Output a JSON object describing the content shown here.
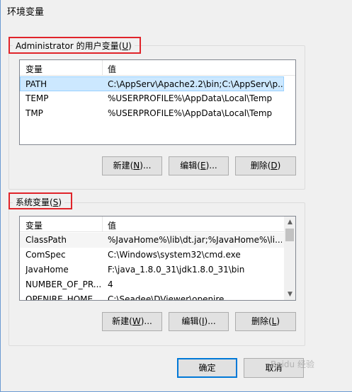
{
  "window": {
    "title": "环境变量"
  },
  "user_group": {
    "label_prefix": "Administrator 的用户变量(",
    "label_key": "U",
    "label_suffix": ")",
    "columns": [
      "变量",
      "值"
    ],
    "rows": [
      {
        "name": "PATH",
        "value": "C:\\AppServ\\Apache2.2\\bin;C:\\AppServ\\p...",
        "selected": true
      },
      {
        "name": "TEMP",
        "value": "%USERPROFILE%\\AppData\\Local\\Temp",
        "selected": false
      },
      {
        "name": "TMP",
        "value": "%USERPROFILE%\\AppData\\Local\\Temp",
        "selected": false
      }
    ],
    "buttons": {
      "new": {
        "a": "新建(",
        "k": "N",
        "b": ")..."
      },
      "edit": {
        "a": "编辑(",
        "k": "E",
        "b": ")..."
      },
      "delete": {
        "a": "删除(",
        "k": "D",
        "b": ")"
      }
    }
  },
  "system_group": {
    "label_prefix": "系统变量(",
    "label_key": "S",
    "label_suffix": ")",
    "columns": [
      "变量",
      "值"
    ],
    "rows": [
      {
        "name": "ClassPath",
        "value": "%JavaHome%\\lib\\dt.jar;%JavaHome%\\li...",
        "selected": false
      },
      {
        "name": "ComSpec",
        "value": "C:\\Windows\\system32\\cmd.exe",
        "selected": false
      },
      {
        "name": "JavaHome",
        "value": "F:\\java_1.8.0_31\\jdk1.8.0_31\\bin",
        "selected": false
      },
      {
        "name": "NUMBER_OF_PR...",
        "value": "4",
        "selected": false
      },
      {
        "name": "OPENIRE_HOME",
        "value": "C:\\Seadee\\DViewer\\openire",
        "selected": false
      }
    ],
    "buttons": {
      "new": {
        "a": "新建(",
        "k": "W",
        "b": ")..."
      },
      "edit": {
        "a": "编辑(",
        "k": "I",
        "b": ")..."
      },
      "delete": {
        "a": "删除(",
        "k": "L",
        "b": ")"
      }
    }
  },
  "footer": {
    "ok": "确定",
    "cancel": "取消"
  },
  "watermark": "Baidu 经验"
}
